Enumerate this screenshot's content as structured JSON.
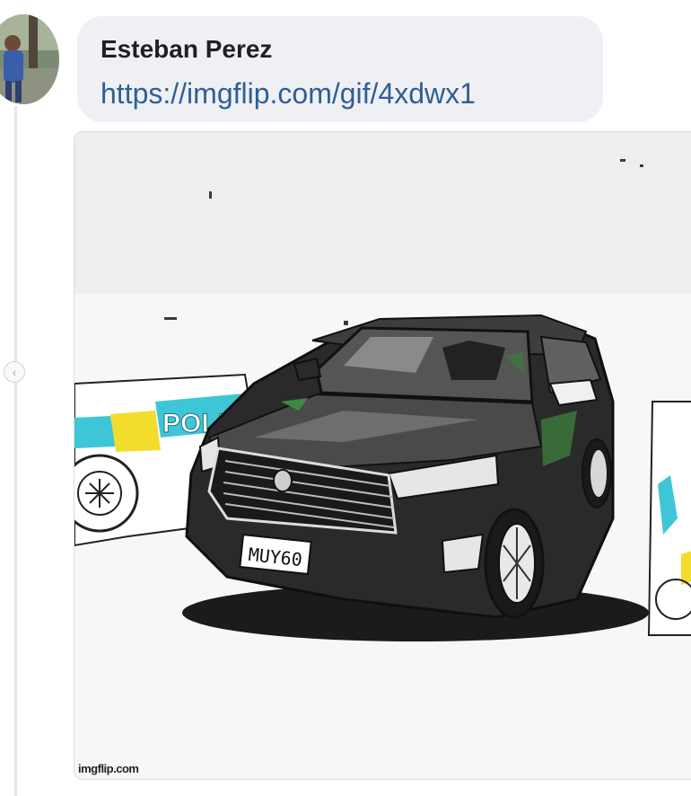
{
  "post": {
    "author": "Esteban Perez",
    "link_text": "https://imgflip.com/gif/4xdwx1"
  },
  "preview": {
    "plate_text": "MUY60",
    "police_text": "POLI",
    "watermark": "imgflip.com"
  },
  "colors": {
    "bubble_bg": "#eef0f4",
    "link": "#2f5f93",
    "police_cyan": "#3fc6d6",
    "police_yellow": "#f2dd2c"
  }
}
